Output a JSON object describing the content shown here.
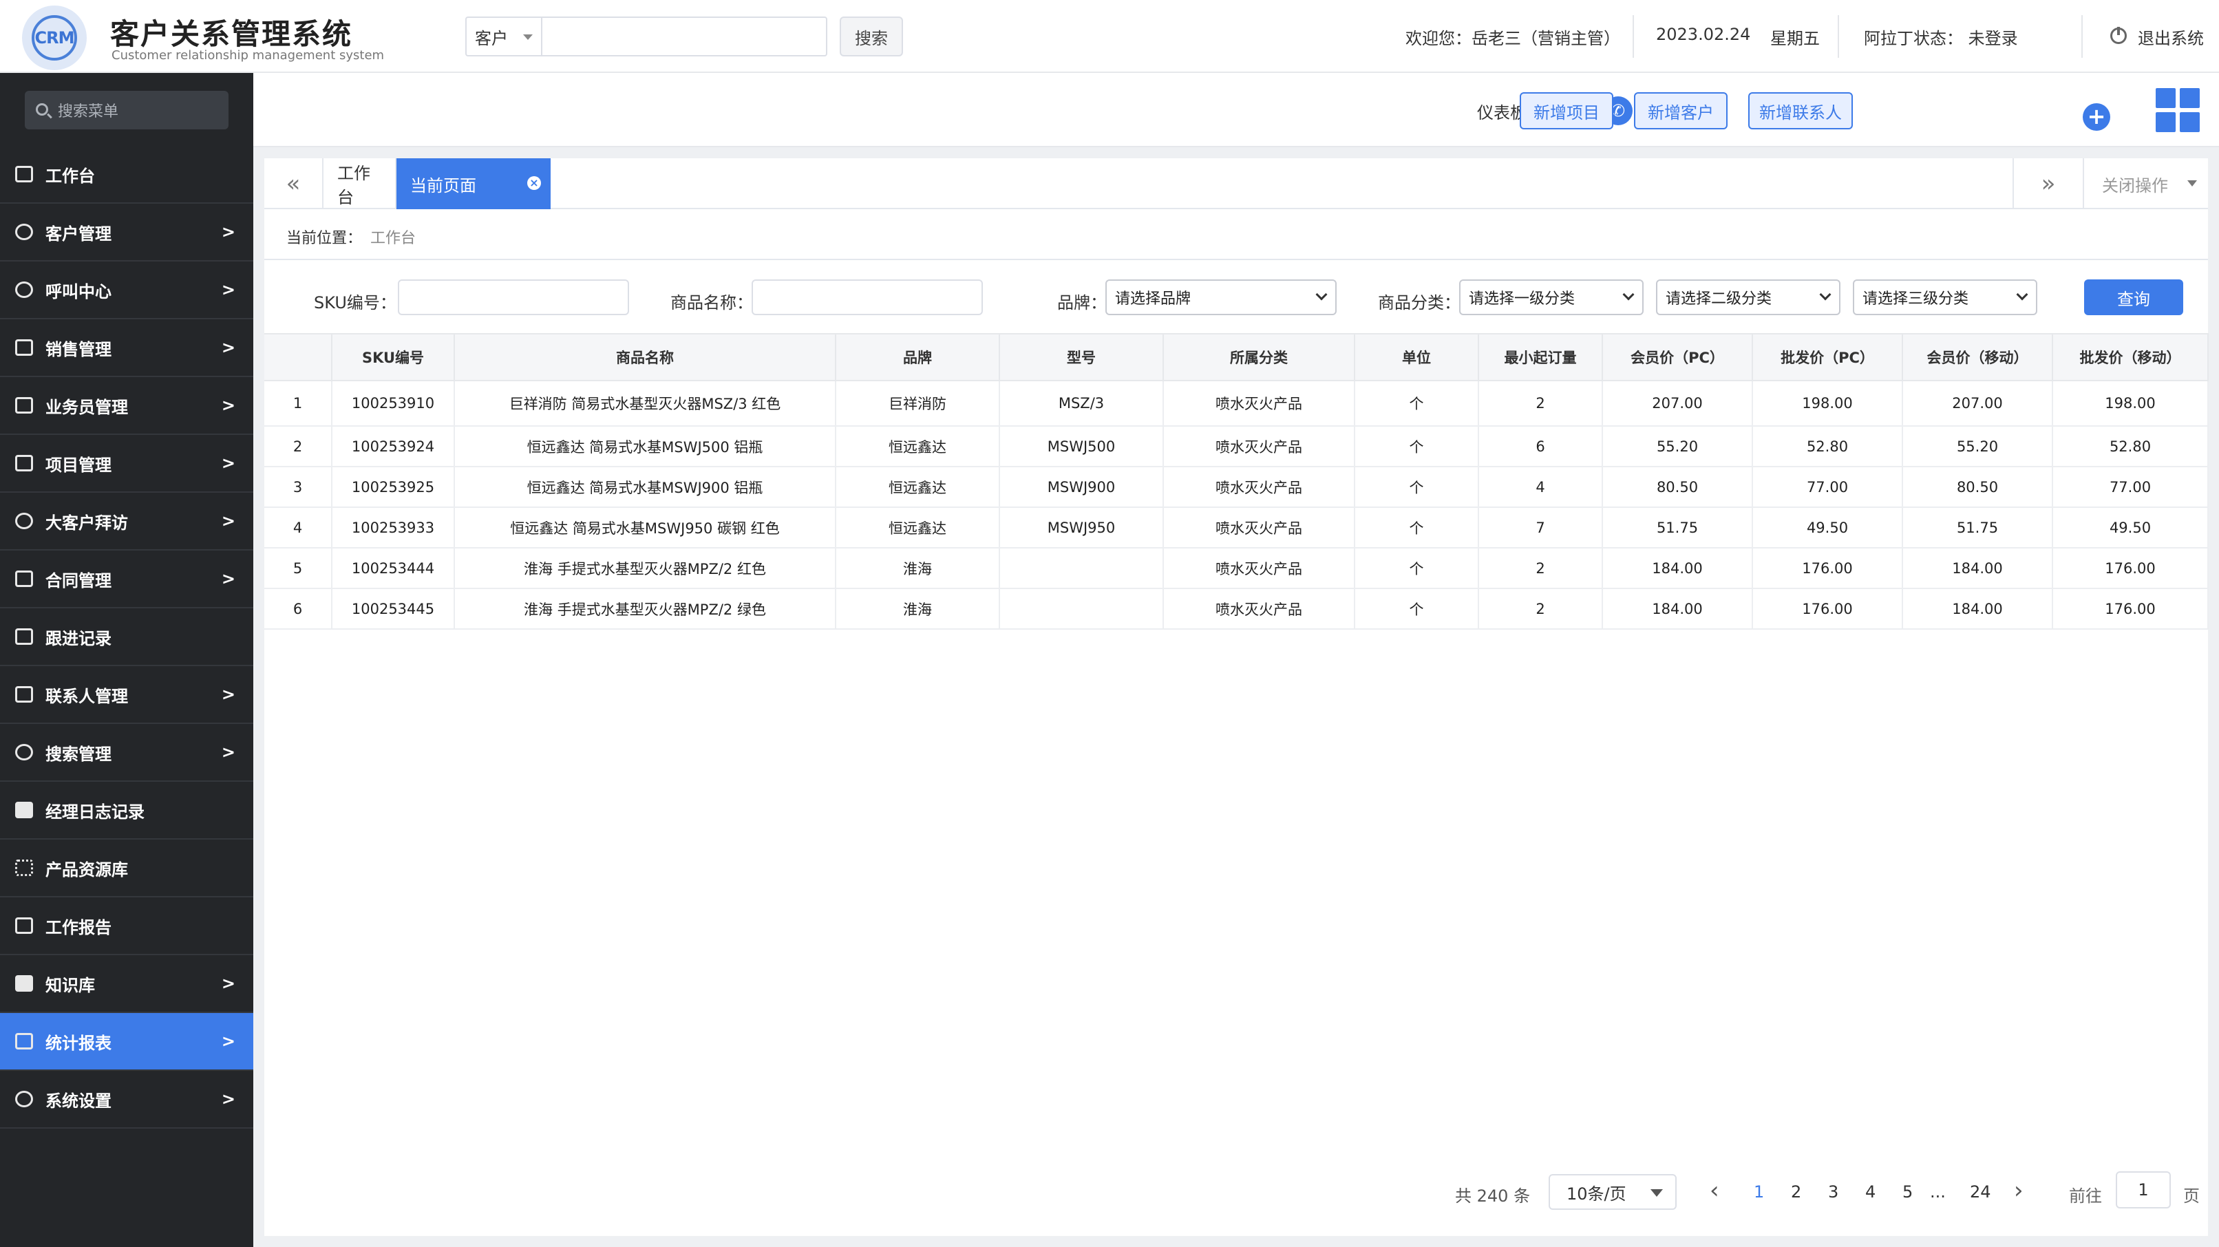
{
  "app": {
    "logo_text": "CRM",
    "title": "客户关系管理系统",
    "subtitle": "Customer relationship management system"
  },
  "header": {
    "search_scope": "客户",
    "search_placeholder": "",
    "search_button": "搜索",
    "welcome": "欢迎您：岳老三（营销主管）",
    "date": "2023.02.24",
    "weekday": "星期五",
    "aladdin_status": "阿拉丁状态：  未登录",
    "logout": "退出系统"
  },
  "sidebar": {
    "search_placeholder": "搜索菜单",
    "items": [
      {
        "label": "工作台",
        "arrow": ""
      },
      {
        "label": "客户管理",
        "arrow": ">"
      },
      {
        "label": "呼叫中心",
        "arrow": ">"
      },
      {
        "label": "销售管理",
        "arrow": ">"
      },
      {
        "label": "业务员管理",
        "arrow": ">"
      },
      {
        "label": "项目管理",
        "arrow": ">"
      },
      {
        "label": "大客户拜访",
        "arrow": ">"
      },
      {
        "label": "合同管理",
        "arrow": ">"
      },
      {
        "label": "跟进记录",
        "arrow": ""
      },
      {
        "label": "联系人管理",
        "arrow": ">"
      },
      {
        "label": "搜索管理",
        "arrow": ">"
      },
      {
        "label": "经理日志记录",
        "arrow": ""
      },
      {
        "label": "产品资源库",
        "arrow": ""
      },
      {
        "label": "工作报告",
        "arrow": ""
      },
      {
        "label": "知识库",
        "arrow": ">"
      },
      {
        "label": "统计报表",
        "arrow": ">"
      },
      {
        "label": "系统设置",
        "arrow": ">"
      }
    ]
  },
  "actionbar": {
    "dashboard": "仪表板",
    "new_project": "新增项目",
    "new_customer": "新增客户",
    "new_contact": "新增联系人"
  },
  "tabs": {
    "workbench": "工作台",
    "current": "当前页面",
    "close_ops": "关闭操作",
    "prev": "«",
    "next": "»"
  },
  "breadcrumb": {
    "label": "当前位置：",
    "value": "工作台"
  },
  "filters": {
    "sku_label": "SKU编号：",
    "name_label": "商品名称：",
    "brand_label": "品牌：",
    "brand_value": "请选择品牌",
    "category_label": "商品分类：",
    "cat1": "请选择一级分类",
    "cat2": "请选择二级分类",
    "cat3": "请选择三级分类",
    "query": "查询"
  },
  "table": {
    "headers": [
      "",
      "SKU编号",
      "商品名称",
      "品牌",
      "型号",
      "所属分类",
      "单位",
      "最小起订量",
      "会员价（PC）",
      "批发价（PC）",
      "会员价（移动）",
      "批发价（移动）"
    ],
    "rows": [
      [
        "1",
        "100253910",
        "巨祥消防 简易式水基型灭火器MSZ/3 红色",
        "巨祥消防",
        "MSZ/3",
        "喷水灭火产品",
        "个",
        "2",
        "207.00",
        "198.00",
        "207.00",
        "198.00"
      ],
      [
        "2",
        "100253924",
        "恒远鑫达 简易式水基MSWJ500 铝瓶",
        "恒远鑫达",
        "MSWJ500",
        "喷水灭火产品",
        "个",
        "6",
        "55.20",
        "52.80",
        "55.20",
        "52.80"
      ],
      [
        "3",
        "100253925",
        "恒远鑫达 简易式水基MSWJ900 铝瓶",
        "恒远鑫达",
        "MSWJ900",
        "喷水灭火产品",
        "个",
        "4",
        "80.50",
        "77.00",
        "80.50",
        "77.00"
      ],
      [
        "4",
        "100253933",
        "恒远鑫达 简易式水基MSWJ950 碳钢 红色",
        "恒远鑫达",
        "MSWJ950",
        "喷水灭火产品",
        "个",
        "7",
        "51.75",
        "49.50",
        "51.75",
        "49.50"
      ],
      [
        "5",
        "100253444",
        "淮海 手提式水基型灭火器MPZ/2 红色",
        "淮海",
        "",
        "喷水灭火产品",
        "个",
        "2",
        "184.00",
        "176.00",
        "184.00",
        "176.00"
      ],
      [
        "6",
        "100253445",
        "淮海 手提式水基型灭火器MPZ/2 绿色",
        "淮海",
        "",
        "喷水灭火产品",
        "个",
        "2",
        "184.00",
        "176.00",
        "184.00",
        "176.00"
      ]
    ]
  },
  "pagination": {
    "total": "共 240 条",
    "page_size": "10条/页",
    "pages": [
      "1",
      "2",
      "3",
      "4",
      "5",
      "...",
      "24"
    ],
    "current": "1",
    "goto_label": "前往",
    "goto_value": "1",
    "page_label": "页",
    "prev": "‹",
    "next": "›"
  },
  "colors": {
    "accent": "#3d7be8",
    "sidebar_bg": "#242629",
    "active_menu": "#3d7be8"
  }
}
